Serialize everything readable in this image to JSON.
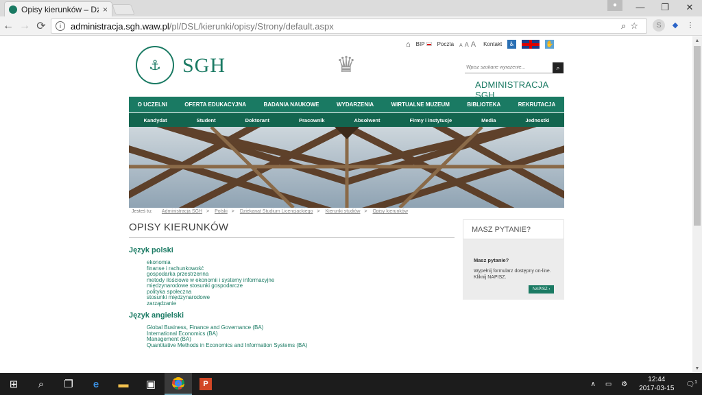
{
  "browser": {
    "tab_title": "Opisy kierunków – Dziek",
    "tab_close": "×",
    "url_host": "administracja.sgh.waw.pl",
    "url_path": "/pl/DSL/kierunki/opisy/Strony/default.aspx",
    "window_min": "—",
    "window_max": "❐",
    "window_close": "✕",
    "back": "←",
    "forward": "→",
    "reload": "⟳"
  },
  "site": {
    "utility": {
      "bip": "BIP",
      "poczta": "Poczta",
      "font_sizes": [
        "A",
        "A",
        "A"
      ],
      "kontakt": "Kontakt"
    },
    "logo_text": "SGH",
    "search_placeholder": "Wpisz szukane wyrażenie...",
    "brand": "ADMINISTRACJA SGH",
    "main_nav": [
      "O UCZELNI",
      "OFERTA EDUKACYJNA",
      "BADANIA NAUKOWE",
      "WYDARZENIA",
      "WIRTUALNE MUZEUM",
      "BIBLIOTEKA",
      "REKRUTACJA"
    ],
    "sub_nav": [
      "Kandydat",
      "Student",
      "Doktorant",
      "Pracownik",
      "Absolwent",
      "Firmy i instytucje",
      "Media",
      "Jednostki"
    ],
    "breadcrumb": {
      "prefix": "Jesteś tu:",
      "items": [
        "Administracja SGH",
        "Polski",
        "Dziekanat Studium Licencjackiego",
        "Kierunki studiów",
        "Opisy kierunków"
      ]
    },
    "page_title": "OPISY KIERUNKÓW",
    "sections": [
      {
        "heading": "Język polski",
        "items": [
          "ekonomia",
          "finanse i rachunkowość",
          "gospodarka przestrzenna",
          "metody ilościowe w ekonomii i systemy informacyjne",
          "międzynarodowe stosunki gospodarcze",
          "polityka społeczna",
          "stosunki międzynarodowe",
          "zarządzanie"
        ]
      },
      {
        "heading": "Język angielski",
        "items": [
          "Global Business, Finance and Governance (BA)",
          "International Economics (BA)",
          "Management (BA)",
          "Quantitative Methods in Economics and Information Systems (BA)"
        ]
      }
    ],
    "sidebar": {
      "heading": "MASZ PYTANIE?",
      "question": "Masz pytanie?",
      "text": "Wypełnij formularz dostępny on-line. Kliknij NAPISZ.",
      "button": "NAPISZ"
    }
  },
  "taskbar": {
    "time": "12:44",
    "date": "2017-03-15",
    "notifications": "1"
  },
  "colors": {
    "sgh_green": "#1a7a63",
    "sgh_dark_green": "#13654f"
  }
}
